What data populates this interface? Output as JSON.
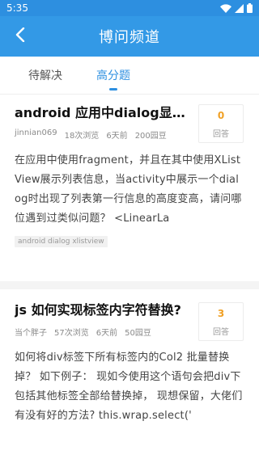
{
  "status": {
    "time": "5:35"
  },
  "header": {
    "title": "博问频道"
  },
  "tabs": [
    {
      "label": "待解决",
      "active": false
    },
    {
      "label": "高分题",
      "active": true
    }
  ],
  "colors": {
    "accent": "#2d8fe0",
    "answer_count": "#f0a024"
  },
  "questions": [
    {
      "title": "android 应用中dialog显示时问题",
      "author": "jinnian069",
      "views": "18次浏览",
      "time": "6天前",
      "bounty": "200园豆",
      "answers": "0",
      "answers_label": "回答",
      "body": "在应用中使用fragment，并且在其中使用XListView展示列表信息，当activity中展示一个dialog时出现了列表第一行信息的高度变高，请问哪位遇到过类似问题？ <LinearLa",
      "tags": "android dialog xlistview"
    },
    {
      "title": "js 如何实现标签内字符替换?",
      "author": "当个胖子",
      "views": "57次浏览",
      "time": "6天前",
      "bounty": "50园豆",
      "answers": "3",
      "answers_label": "回答",
      "body": "如何将div标签下所有标签内的Col2 批量替换掉？ 如下例子： 现如今使用这个语句会把div下包括其他标签全部给替换掉， 现想保留，大佬们有没有好的方法? this.wrap.select('"
    }
  ]
}
